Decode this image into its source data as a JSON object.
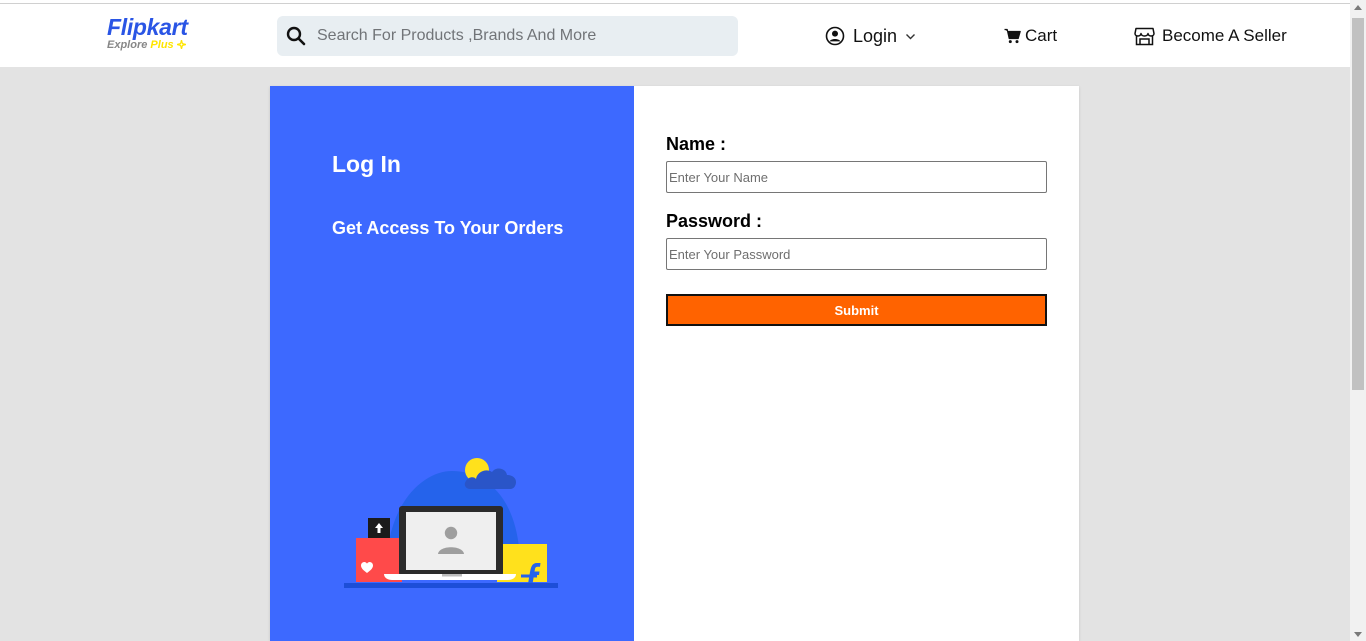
{
  "header": {
    "logo": {
      "brand": "Flipkart",
      "tagline_prefix": "Explore",
      "tagline_plus": "Plus"
    },
    "search": {
      "placeholder": "Search For Products ,Brands And More",
      "value": ""
    },
    "nav": {
      "login_label": "Login",
      "cart_label": "Cart",
      "seller_label": "Become A Seller"
    }
  },
  "login_panel": {
    "title": "Log In",
    "subtitle": "Get Access To Your Orders"
  },
  "form": {
    "name_label": "Name :",
    "name_placeholder": "Enter Your Name",
    "name_value": "",
    "password_label": "Password :",
    "password_placeholder": "Enter Your Password",
    "password_value": "",
    "submit_label": "Submit"
  },
  "colors": {
    "brand_blue": "#2a55e5",
    "panel_blue": "#3d69ff",
    "submit_orange": "#ff6300",
    "plus_yellow": "#ffe500"
  },
  "icons": {
    "search": "search-icon",
    "login": "user-circle-icon",
    "dropdown": "chevron-down-icon",
    "cart": "cart-icon",
    "seller": "store-icon"
  }
}
